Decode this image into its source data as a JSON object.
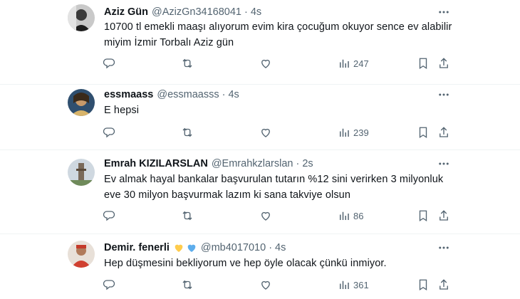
{
  "tweets": [
    {
      "name": "Aziz Gün",
      "handle": "@AzizGn34168041",
      "time": "4s",
      "text": "10700 tl emekli maaşı alıyorum evim kira çocuğum okuyor sence ev alabilir miyim İzmir Torbalı Aziz gün",
      "views": "247",
      "avatar_icon": "avatar-photo-icon"
    },
    {
      "name": "essmaass",
      "handle": "@essmaasss",
      "time": "4s",
      "text": "E hepsi",
      "views": "239",
      "avatar_icon": "avatar-photo-icon"
    },
    {
      "name": "Emrah KIZILARSLAN",
      "handle": "@Emrahkzlarslan",
      "time": "2s",
      "text": "Ev almak hayal bankalar başvurulan tutarın %12 sini verirken 3 milyonluk eve 30 milyon başvurmak lazım ki sana takviye olsun",
      "views": "86",
      "avatar_icon": "avatar-photo-icon"
    },
    {
      "name": "Demir. fenerli",
      "handle": "@mb4017010",
      "time": "4s",
      "text": "Hep düşmesini bekliyorum ve hep öyle olacak çünkü inmiyor.",
      "views": "361",
      "avatar_icon": "avatar-photo-icon",
      "name_emoji": [
        "yellow-heart-icon",
        "blue-heart-icon"
      ]
    }
  ],
  "separator": "·",
  "colors": {
    "text": "#0f1419",
    "secondary": "#536471",
    "divider": "#eff3f4",
    "yellow_heart": "#ffcc4d",
    "blue_heart": "#5dadec"
  },
  "action_icons": [
    "reply-icon",
    "retweet-icon",
    "like-icon",
    "views-icon",
    "bookmark-icon",
    "share-icon"
  ],
  "more_icon": "more-options-icon"
}
